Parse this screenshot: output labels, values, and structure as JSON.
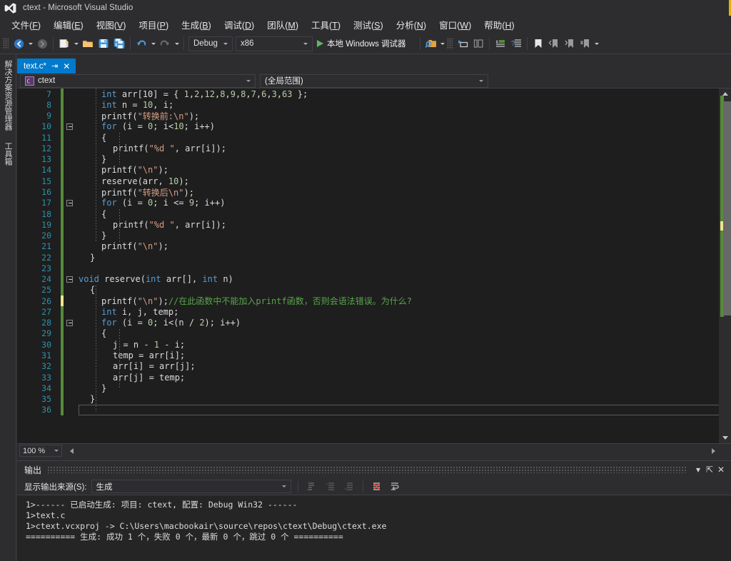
{
  "window": {
    "title": "ctext - Microsoft Visual Studio",
    "logo_icon": "visual-studio-logo-icon"
  },
  "menubar": {
    "items": [
      {
        "label": "文件",
        "accel": "F"
      },
      {
        "label": "编辑",
        "accel": "E"
      },
      {
        "label": "视图",
        "accel": "V"
      },
      {
        "label": "项目",
        "accel": "P"
      },
      {
        "label": "生成",
        "accel": "B"
      },
      {
        "label": "调试",
        "accel": "D"
      },
      {
        "label": "团队",
        "accel": "M"
      },
      {
        "label": "工具",
        "accel": "T"
      },
      {
        "label": "测试",
        "accel": "S"
      },
      {
        "label": "分析",
        "accel": "N"
      },
      {
        "label": "窗口",
        "accel": "W"
      },
      {
        "label": "帮助",
        "accel": "H"
      }
    ]
  },
  "toolbar": {
    "nav_back_icon": "navigate-back-icon",
    "nav_forward_icon": "navigate-forward-icon",
    "new_project_icon": "new-project-icon",
    "open_file_icon": "open-file-icon",
    "save_icon": "save-icon",
    "save_all_icon": "save-all-icon",
    "undo_icon": "undo-icon",
    "redo_icon": "redo-icon",
    "config_value": "Debug",
    "platform_value": "x86",
    "run_label": "本地 Windows 调试器",
    "run_icon": "play-icon",
    "find_icon": "find-in-files-icon",
    "step_into_icon": "step-into-icon",
    "step_over_icon": "step-over-icon",
    "indent_icon": "indent-icon",
    "comment_icon": "comment-icon",
    "bookmark_icon": "bookmark-icon",
    "prev_bookmark_icon": "previous-bookmark-icon",
    "next_bookmark_icon": "next-bookmark-icon",
    "clear_bookmark_icon": "clear-bookmarks-icon",
    "overflow_icon": "toolbar-overflow-icon"
  },
  "leftrail": {
    "items": [
      {
        "label": "解决方案资源管理器",
        "name": "solution-explorer"
      },
      {
        "label": "工具箱",
        "name": "toolbox"
      }
    ]
  },
  "tabs": {
    "active": {
      "label": "text.c*",
      "pin_icon": "pin-icon",
      "close_icon": "close-icon"
    }
  },
  "navbar": {
    "scope_project": "ctext",
    "scope_project_icon": "c-file-icon",
    "scope_member": "(全局范围)",
    "dropdown_icon": "chevron-down-icon"
  },
  "editor": {
    "first_line": 7,
    "lines": [
      {
        "n": 7,
        "indent": 2,
        "tokens": [
          [
            "kw",
            "int"
          ],
          [
            "pl",
            " arr[10] = { "
          ],
          [
            "num",
            "1"
          ],
          [
            "pl",
            ","
          ],
          [
            "num",
            "2"
          ],
          [
            "pl",
            ","
          ],
          [
            "num",
            "12"
          ],
          [
            "pl",
            ","
          ],
          [
            "num",
            "8"
          ],
          [
            "pl",
            ","
          ],
          [
            "num",
            "9"
          ],
          [
            "pl",
            ","
          ],
          [
            "num",
            "8"
          ],
          [
            "pl",
            ","
          ],
          [
            "num",
            "7"
          ],
          [
            "pl",
            ","
          ],
          [
            "num",
            "6"
          ],
          [
            "pl",
            ","
          ],
          [
            "num",
            "3"
          ],
          [
            "pl",
            ","
          ],
          [
            "num",
            "63"
          ],
          [
            "pl",
            " };"
          ]
        ]
      },
      {
        "n": 8,
        "indent": 2,
        "tokens": [
          [
            "kw",
            "int"
          ],
          [
            "pl",
            " n = "
          ],
          [
            "num",
            "10"
          ],
          [
            "pl",
            ", i;"
          ]
        ]
      },
      {
        "n": 9,
        "indent": 2,
        "tokens": [
          [
            "pl",
            "printf("
          ],
          [
            "str",
            "\"转换前:\\n\""
          ],
          [
            "pl",
            ");"
          ]
        ]
      },
      {
        "n": 10,
        "indent": 2,
        "fold": true,
        "tokens": [
          [
            "kw",
            "for"
          ],
          [
            "pl",
            " (i = "
          ],
          [
            "num",
            "0"
          ],
          [
            "pl",
            "; i<"
          ],
          [
            "num",
            "10"
          ],
          [
            "pl",
            "; i++)"
          ]
        ]
      },
      {
        "n": 11,
        "indent": 2,
        "tokens": [
          [
            "pl",
            "{"
          ]
        ]
      },
      {
        "n": 12,
        "indent": 3,
        "tokens": [
          [
            "pl",
            "printf("
          ],
          [
            "str",
            "\"%d \""
          ],
          [
            "pl",
            ", arr[i]);"
          ]
        ]
      },
      {
        "n": 13,
        "indent": 2,
        "tokens": [
          [
            "pl",
            "}"
          ]
        ]
      },
      {
        "n": 14,
        "indent": 2,
        "tokens": [
          [
            "pl",
            "printf("
          ],
          [
            "str",
            "\"\\n\""
          ],
          [
            "pl",
            ");"
          ]
        ]
      },
      {
        "n": 15,
        "indent": 2,
        "tokens": [
          [
            "pl",
            "reserve(arr, "
          ],
          [
            "num",
            "10"
          ],
          [
            "pl",
            ");"
          ]
        ]
      },
      {
        "n": 16,
        "indent": 2,
        "tokens": [
          [
            "pl",
            "printf("
          ],
          [
            "str",
            "\"转换后\\n\""
          ],
          [
            "pl",
            ");"
          ]
        ]
      },
      {
        "n": 17,
        "indent": 2,
        "fold": true,
        "tokens": [
          [
            "kw",
            "for"
          ],
          [
            "pl",
            " (i = "
          ],
          [
            "num",
            "0"
          ],
          [
            "pl",
            "; i <= "
          ],
          [
            "num",
            "9"
          ],
          [
            "pl",
            "; i++)"
          ]
        ]
      },
      {
        "n": 18,
        "indent": 2,
        "tokens": [
          [
            "pl",
            "{"
          ]
        ]
      },
      {
        "n": 19,
        "indent": 3,
        "tokens": [
          [
            "pl",
            "printf("
          ],
          [
            "str",
            "\"%d \""
          ],
          [
            "pl",
            ", arr[i]);"
          ]
        ]
      },
      {
        "n": 20,
        "indent": 2,
        "tokens": [
          [
            "pl",
            "}"
          ]
        ]
      },
      {
        "n": 21,
        "indent": 2,
        "tokens": [
          [
            "pl",
            "printf("
          ],
          [
            "str",
            "\"\\n\""
          ],
          [
            "pl",
            ");"
          ]
        ]
      },
      {
        "n": 22,
        "indent": 1,
        "tokens": [
          [
            "pl",
            "}"
          ]
        ]
      },
      {
        "n": 23,
        "indent": 0,
        "tokens": [
          [
            "pl",
            ""
          ]
        ]
      },
      {
        "n": 24,
        "indent": 0,
        "fold": true,
        "tokens": [
          [
            "kw",
            "void"
          ],
          [
            "pl",
            " reserve("
          ],
          [
            "kw",
            "int"
          ],
          [
            "pl",
            " arr[], "
          ],
          [
            "kw",
            "int"
          ],
          [
            "pl",
            " n)"
          ]
        ]
      },
      {
        "n": 25,
        "indent": 1,
        "tokens": [
          [
            "pl",
            "{"
          ]
        ]
      },
      {
        "n": 26,
        "indent": 2,
        "modified": true,
        "tokens": [
          [
            "pl",
            "printf("
          ],
          [
            "str",
            "\"\\n\""
          ],
          [
            "pl",
            ");"
          ],
          [
            "cmt",
            "//在此函数中不能加入printf函数，否则会语法错误。为什么?"
          ]
        ]
      },
      {
        "n": 27,
        "indent": 2,
        "tokens": [
          [
            "kw",
            "int"
          ],
          [
            "pl",
            " i, j, temp;"
          ]
        ]
      },
      {
        "n": 28,
        "indent": 2,
        "fold": true,
        "tokens": [
          [
            "kw",
            "for"
          ],
          [
            "pl",
            " (i = "
          ],
          [
            "num",
            "0"
          ],
          [
            "pl",
            "; i<(n / "
          ],
          [
            "num",
            "2"
          ],
          [
            "pl",
            "); i++)"
          ]
        ]
      },
      {
        "n": 29,
        "indent": 2,
        "tokens": [
          [
            "pl",
            "{"
          ]
        ]
      },
      {
        "n": 30,
        "indent": 3,
        "tokens": [
          [
            "pl",
            "j = n - "
          ],
          [
            "num",
            "1"
          ],
          [
            "pl",
            " - i;"
          ]
        ]
      },
      {
        "n": 31,
        "indent": 3,
        "tokens": [
          [
            "pl",
            "temp = arr[i];"
          ]
        ]
      },
      {
        "n": 32,
        "indent": 3,
        "tokens": [
          [
            "pl",
            "arr[i] = arr[j];"
          ]
        ]
      },
      {
        "n": 33,
        "indent": 3,
        "tokens": [
          [
            "pl",
            "arr[j] = temp;"
          ]
        ]
      },
      {
        "n": 34,
        "indent": 2,
        "tokens": [
          [
            "pl",
            "}"
          ]
        ]
      },
      {
        "n": 35,
        "indent": 1,
        "tokens": [
          [
            "pl",
            "}"
          ]
        ]
      },
      {
        "n": 36,
        "indent": 0,
        "cursor": true,
        "tokens": [
          [
            "pl",
            ""
          ]
        ]
      }
    ]
  },
  "statusrow": {
    "zoom": "100 %",
    "zoom_dropdown_icon": "chevron-down-icon",
    "hscroll_left_icon": "scroll-left-icon",
    "hscroll_right_icon": "scroll-right-icon"
  },
  "output": {
    "title": "输出",
    "dropdown_icon": "chevron-down-icon",
    "pin_icon": "pin-icon",
    "close_icon": "close-icon",
    "source_label": "显示输出来源(S):",
    "source_value": "生成",
    "source_dropdown_icon": "chevron-down-icon",
    "btn_goto_prev_icon": "goto-previous-message-icon",
    "btn_goto_next_icon": "goto-next-message-icon",
    "btn_goto_icon": "goto-message-icon",
    "btn_clear_icon": "clear-output-icon",
    "btn_wordwrap_icon": "toggle-word-wrap-icon",
    "lines": [
      "1>------ 已启动生成: 项目: ctext, 配置: Debug Win32 ------",
      "1>text.c",
      "1>ctext.vcxproj -> C:\\Users\\macbookair\\source\\repos\\ctext\\Debug\\ctext.exe",
      "========== 生成: 成功 1 个，失败 0 个，最新 0 个，跳过 0 个 =========="
    ]
  },
  "colors": {
    "accent": "#007acc",
    "chrome": "#2d2d30",
    "editor_bg": "#1e1e1e",
    "keyword": "#569cd6",
    "string": "#d69d85",
    "comment": "#57a64a",
    "number": "#b5cea8",
    "linenumber": "#2b91af",
    "change_bar": "#57893a",
    "unsaved_bar": "#f0e68c",
    "window_edge": "#e8b007"
  }
}
